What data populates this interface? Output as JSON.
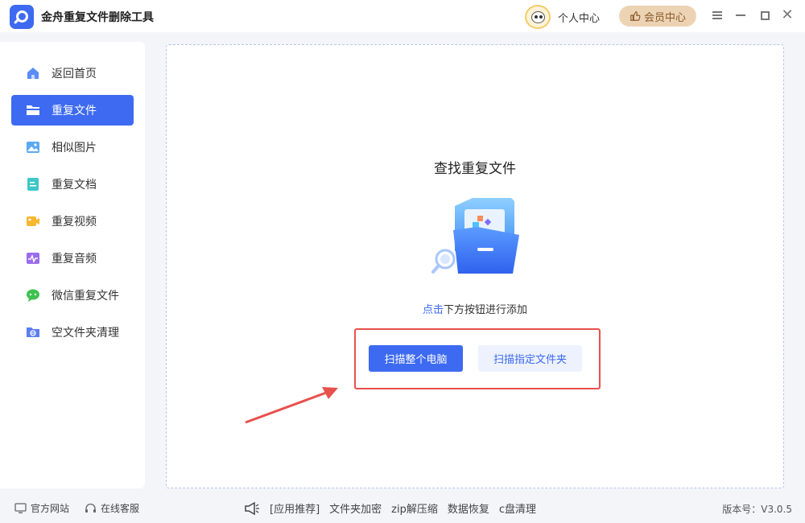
{
  "app": {
    "title": "金舟重复文件删除工具"
  },
  "header": {
    "personal_center": "个人中心",
    "vip_center": "会员中心"
  },
  "sidebar": {
    "items": [
      {
        "label": "返回首页",
        "icon": "home-icon"
      },
      {
        "label": "重复文件",
        "icon": "folder-icon",
        "active": true
      },
      {
        "label": "相似图片",
        "icon": "image-icon"
      },
      {
        "label": "重复文档",
        "icon": "document-icon"
      },
      {
        "label": "重复视频",
        "icon": "video-icon"
      },
      {
        "label": "重复音频",
        "icon": "audio-icon"
      },
      {
        "label": "微信重复文件",
        "icon": "wechat-icon"
      },
      {
        "label": "空文件夹清理",
        "icon": "empty-folder-icon"
      }
    ]
  },
  "main": {
    "title": "查找重复文件",
    "hint_link": "点击",
    "hint_rest": "下方按钮进行添加",
    "scan_pc": "扫描整个电脑",
    "scan_folder": "扫描指定文件夹"
  },
  "footer": {
    "website": "官方网站",
    "support": "在线客服",
    "promo_label": "[应用推荐]",
    "links": [
      "文件夹加密",
      "zip解压缩",
      "数据恢复",
      "c盘清理"
    ],
    "version_label": "版本号：",
    "version": "V3.0.5"
  },
  "colors": {
    "accent": "#3d6af0",
    "vip_bg": "#ecd3b4",
    "highlight": "#e8504c"
  }
}
